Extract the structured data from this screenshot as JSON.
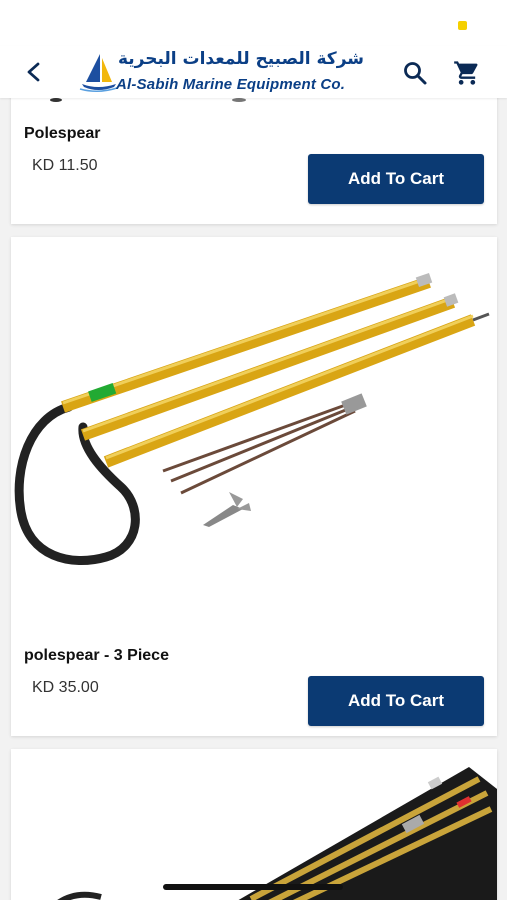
{
  "header": {
    "brand_arabic": "شركة الصبيح للمعدات البحرية",
    "brand_english": "Al-Sabih Marine Equipment Co."
  },
  "products": [
    {
      "name": "Polespear",
      "price": "KD 11.50",
      "button": "Add To Cart"
    },
    {
      "name": "polespear - 3 Piece",
      "price": "KD 35.00",
      "button": "Add To Cart"
    }
  ],
  "icons": {
    "back": "chevron-left-icon",
    "search": "search-icon",
    "cart": "cart-icon"
  },
  "colors": {
    "brand_blue": "#0b3f86",
    "button_blue": "#0b3a73",
    "rod_gold": "#d9a514"
  }
}
